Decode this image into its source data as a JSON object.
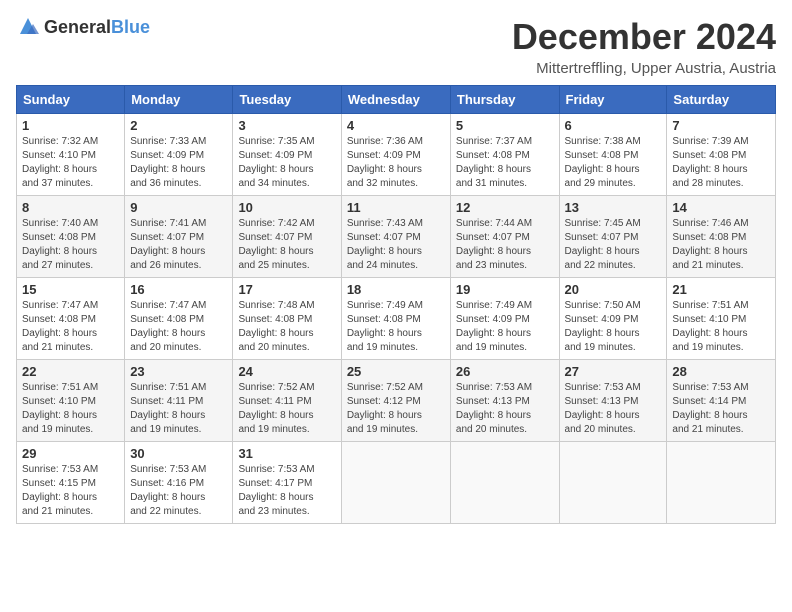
{
  "header": {
    "logo_general": "General",
    "logo_blue": "Blue",
    "title": "December 2024",
    "subtitle": "Mittertreffling, Upper Austria, Austria"
  },
  "weekdays": [
    "Sunday",
    "Monday",
    "Tuesday",
    "Wednesday",
    "Thursday",
    "Friday",
    "Saturday"
  ],
  "weeks": [
    [
      {
        "day": "1",
        "info": "Sunrise: 7:32 AM\nSunset: 4:10 PM\nDaylight: 8 hours\nand 37 minutes."
      },
      {
        "day": "2",
        "info": "Sunrise: 7:33 AM\nSunset: 4:09 PM\nDaylight: 8 hours\nand 36 minutes."
      },
      {
        "day": "3",
        "info": "Sunrise: 7:35 AM\nSunset: 4:09 PM\nDaylight: 8 hours\nand 34 minutes."
      },
      {
        "day": "4",
        "info": "Sunrise: 7:36 AM\nSunset: 4:09 PM\nDaylight: 8 hours\nand 32 minutes."
      },
      {
        "day": "5",
        "info": "Sunrise: 7:37 AM\nSunset: 4:08 PM\nDaylight: 8 hours\nand 31 minutes."
      },
      {
        "day": "6",
        "info": "Sunrise: 7:38 AM\nSunset: 4:08 PM\nDaylight: 8 hours\nand 29 minutes."
      },
      {
        "day": "7",
        "info": "Sunrise: 7:39 AM\nSunset: 4:08 PM\nDaylight: 8 hours\nand 28 minutes."
      }
    ],
    [
      {
        "day": "8",
        "info": "Sunrise: 7:40 AM\nSunset: 4:08 PM\nDaylight: 8 hours\nand 27 minutes."
      },
      {
        "day": "9",
        "info": "Sunrise: 7:41 AM\nSunset: 4:07 PM\nDaylight: 8 hours\nand 26 minutes."
      },
      {
        "day": "10",
        "info": "Sunrise: 7:42 AM\nSunset: 4:07 PM\nDaylight: 8 hours\nand 25 minutes."
      },
      {
        "day": "11",
        "info": "Sunrise: 7:43 AM\nSunset: 4:07 PM\nDaylight: 8 hours\nand 24 minutes."
      },
      {
        "day": "12",
        "info": "Sunrise: 7:44 AM\nSunset: 4:07 PM\nDaylight: 8 hours\nand 23 minutes."
      },
      {
        "day": "13",
        "info": "Sunrise: 7:45 AM\nSunset: 4:07 PM\nDaylight: 8 hours\nand 22 minutes."
      },
      {
        "day": "14",
        "info": "Sunrise: 7:46 AM\nSunset: 4:08 PM\nDaylight: 8 hours\nand 21 minutes."
      }
    ],
    [
      {
        "day": "15",
        "info": "Sunrise: 7:47 AM\nSunset: 4:08 PM\nDaylight: 8 hours\nand 21 minutes."
      },
      {
        "day": "16",
        "info": "Sunrise: 7:47 AM\nSunset: 4:08 PM\nDaylight: 8 hours\nand 20 minutes."
      },
      {
        "day": "17",
        "info": "Sunrise: 7:48 AM\nSunset: 4:08 PM\nDaylight: 8 hours\nand 20 minutes."
      },
      {
        "day": "18",
        "info": "Sunrise: 7:49 AM\nSunset: 4:08 PM\nDaylight: 8 hours\nand 19 minutes."
      },
      {
        "day": "19",
        "info": "Sunrise: 7:49 AM\nSunset: 4:09 PM\nDaylight: 8 hours\nand 19 minutes."
      },
      {
        "day": "20",
        "info": "Sunrise: 7:50 AM\nSunset: 4:09 PM\nDaylight: 8 hours\nand 19 minutes."
      },
      {
        "day": "21",
        "info": "Sunrise: 7:51 AM\nSunset: 4:10 PM\nDaylight: 8 hours\nand 19 minutes."
      }
    ],
    [
      {
        "day": "22",
        "info": "Sunrise: 7:51 AM\nSunset: 4:10 PM\nDaylight: 8 hours\nand 19 minutes."
      },
      {
        "day": "23",
        "info": "Sunrise: 7:51 AM\nSunset: 4:11 PM\nDaylight: 8 hours\nand 19 minutes."
      },
      {
        "day": "24",
        "info": "Sunrise: 7:52 AM\nSunset: 4:11 PM\nDaylight: 8 hours\nand 19 minutes."
      },
      {
        "day": "25",
        "info": "Sunrise: 7:52 AM\nSunset: 4:12 PM\nDaylight: 8 hours\nand 19 minutes."
      },
      {
        "day": "26",
        "info": "Sunrise: 7:53 AM\nSunset: 4:13 PM\nDaylight: 8 hours\nand 20 minutes."
      },
      {
        "day": "27",
        "info": "Sunrise: 7:53 AM\nSunset: 4:13 PM\nDaylight: 8 hours\nand 20 minutes."
      },
      {
        "day": "28",
        "info": "Sunrise: 7:53 AM\nSunset: 4:14 PM\nDaylight: 8 hours\nand 21 minutes."
      }
    ],
    [
      {
        "day": "29",
        "info": "Sunrise: 7:53 AM\nSunset: 4:15 PM\nDaylight: 8 hours\nand 21 minutes."
      },
      {
        "day": "30",
        "info": "Sunrise: 7:53 AM\nSunset: 4:16 PM\nDaylight: 8 hours\nand 22 minutes."
      },
      {
        "day": "31",
        "info": "Sunrise: 7:53 AM\nSunset: 4:17 PM\nDaylight: 8 hours\nand 23 minutes."
      },
      {
        "day": "",
        "info": ""
      },
      {
        "day": "",
        "info": ""
      },
      {
        "day": "",
        "info": ""
      },
      {
        "day": "",
        "info": ""
      }
    ]
  ]
}
